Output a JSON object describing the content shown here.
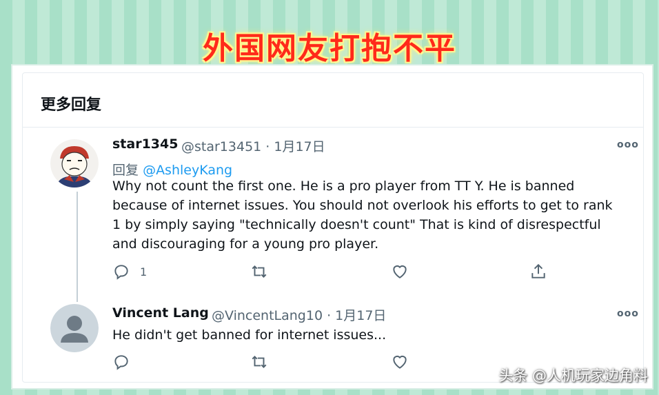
{
  "banner_title": "外国网友打抱不平",
  "section_title": "更多回复",
  "tweets": [
    {
      "name": "star1345",
      "handle_time": "@star13451 · 1月17日",
      "replying_label": "回复",
      "replying_to": "@AshleyKang",
      "lines": [
        "Why not count the first one. He is a pro player from TT Y.  He is banned",
        "because of internet issues. You should not overlook his efforts to get to rank",
        "1 by simply saying \"technically doesn't count\" That is kind of disrespectful",
        "and discouraging for a young pro player."
      ],
      "reply_count": "1",
      "more": "ooo"
    },
    {
      "name": "Vincent Lang",
      "handle_time": "@VincentLang10 · 1月17日",
      "text": "He didn't get banned for internet issues...",
      "more": "ooo"
    }
  ],
  "watermark": "头条 @人机玩家边角料",
  "colors": {
    "accent": "#1d9bf0",
    "banner_text": "#ff2a1a",
    "muted": "#536471",
    "background_stripe_a": "#a8e0c8",
    "background_stripe_b": "#bfe9d6"
  },
  "icons": [
    "reply-icon",
    "retweet-icon",
    "like-icon",
    "share-icon",
    "more-icon"
  ]
}
